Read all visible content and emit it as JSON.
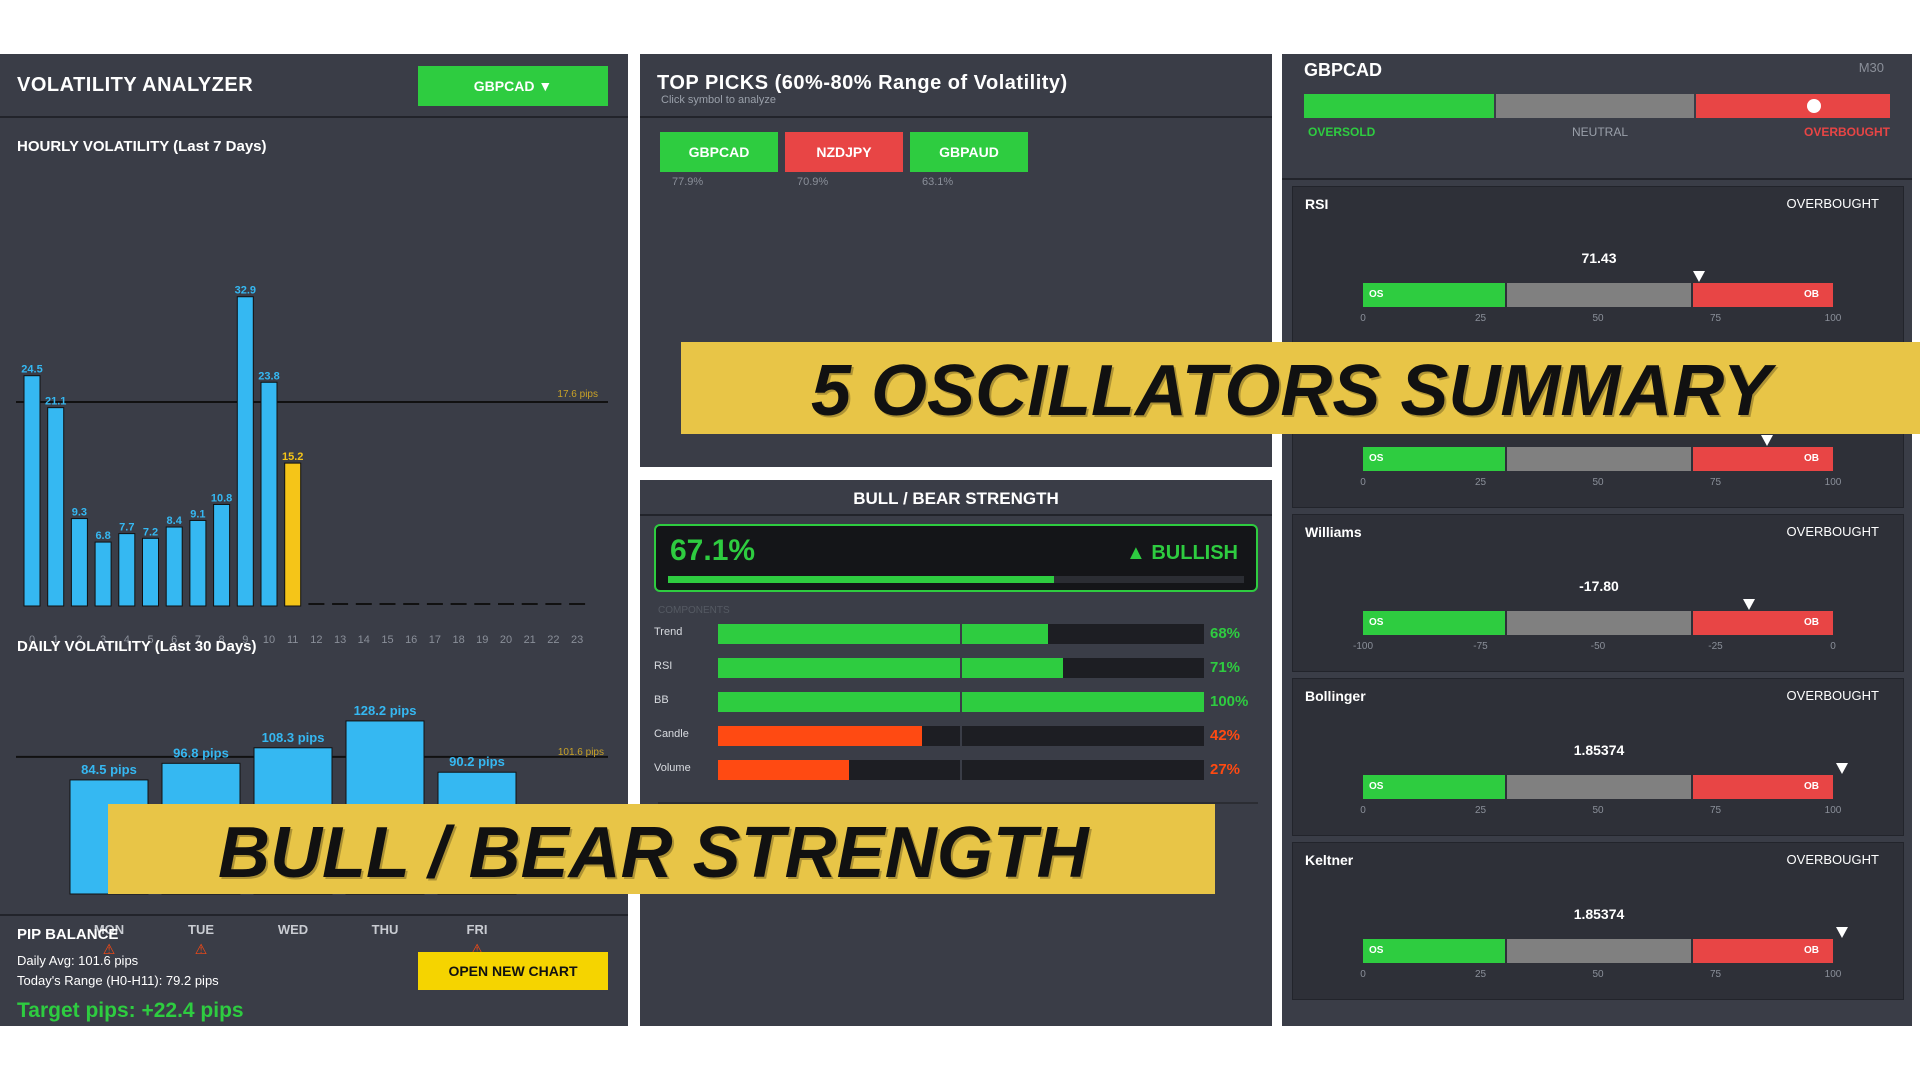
{
  "left": {
    "title": "VOLATILITY ANALYZER",
    "symbol_button": "GBPCAD ▼",
    "hourly": {
      "title": "HOURLY VOLATILITY (Last 7 Days)",
      "avg_label": "17.6 pips",
      "hours": [
        "0",
        "1",
        "2",
        "3",
        "4",
        "5",
        "6",
        "7",
        "8",
        "9",
        "10",
        "11",
        "12",
        "13",
        "14",
        "15",
        "16",
        "17",
        "18",
        "19",
        "20",
        "21",
        "22",
        "23"
      ],
      "values": [
        24.5,
        21.1,
        9.3,
        6.8,
        7.7,
        7.2,
        8.4,
        9.1,
        10.8,
        32.9,
        23.8,
        15.2
      ],
      "value_labels": [
        "24.5",
        "21.1",
        "9.3",
        "6.8",
        "7.7",
        "7.2",
        "8.4",
        "9.1",
        "10.8",
        "32.9",
        "23.8",
        "15.2"
      ],
      "current_hour_index": 11
    },
    "daily": {
      "title": "DAILY VOLATILITY (Last 30 Days)",
      "avg_label": "101.6 pips",
      "days": [
        "MON",
        "TUE",
        "WED",
        "THU",
        "FRI"
      ],
      "values": [
        84.5,
        96.8,
        108.3,
        128.2,
        90.2
      ],
      "value_labels": [
        "84.5 pips",
        "96.8 pips",
        "108.3 pips",
        "128.2 pips",
        "90.2 pips"
      ],
      "warnings": [
        "⚠",
        "⚠",
        "",
        "",
        "⚠"
      ]
    },
    "pip_balance": {
      "title": "PIP BALANCE",
      "daily_avg": "Daily Avg: 101.6 pips",
      "todays_range": "Today's Range (H0-H11): 79.2 pips",
      "target": "Target pips: +22.4 pips",
      "open_chart_button": "OPEN NEW CHART"
    }
  },
  "top_picks": {
    "title": "TOP PICKS (60%-80% Range of Volatility)",
    "subtitle": "Click symbol to analyze",
    "picks": [
      {
        "symbol": "GBPCAD",
        "pct": "77.9%",
        "color": "#2ecc40"
      },
      {
        "symbol": "NZDJPY",
        "pct": "70.9%",
        "color": "#e84545"
      },
      {
        "symbol": "GBPAUD",
        "pct": "63.1%",
        "color": "#2ecc40"
      }
    ]
  },
  "bull_bear": {
    "title": "BULL / BEAR STRENGTH",
    "score": "67.1%",
    "score_value": 67.1,
    "direction": "▲ BULLISH",
    "components_label": "COMPONENTS",
    "components": [
      {
        "name": "Trend",
        "value": 68,
        "label": "68%",
        "color": "#2ecc40"
      },
      {
        "name": "RSI",
        "value": 71,
        "label": "71%",
        "color": "#2ecc40"
      },
      {
        "name": "BB",
        "value": 100,
        "label": "100%",
        "color": "#2ecc40"
      },
      {
        "name": "Candle",
        "value": 42,
        "label": "42%",
        "color": "#ff4a12"
      },
      {
        "name": "Volume",
        "value": 27,
        "label": "27%",
        "color": "#ff4a12"
      }
    ]
  },
  "summary": {
    "symbol": "GBPCAD",
    "timeframe": "M30",
    "oversold": "OVERSOLD",
    "neutral": "NEUTRAL",
    "overbought": "OVERBOUGHT",
    "marker_position": 0.87
  },
  "oscillators": [
    {
      "name": "RSI",
      "status": "OVERBOUGHT",
      "value": "71.43",
      "marker": 0.7143,
      "ticks": [
        "0",
        "25",
        "50",
        "75",
        "100"
      ]
    },
    {
      "name": "",
      "status": "",
      "value": "",
      "marker": 0.86,
      "ticks": [
        "0",
        "25",
        "50",
        "75",
        "100"
      ]
    },
    {
      "name": "Williams",
      "status": "OVERBOUGHT",
      "value": "-17.80",
      "marker": 0.822,
      "ticks": [
        "-100",
        "-75",
        "-50",
        "-25",
        "0"
      ]
    },
    {
      "name": "Bollinger",
      "status": "OVERBOUGHT",
      "value": "1.85374",
      "marker": 1.02,
      "ticks": [
        "0",
        "25",
        "50",
        "75",
        "100"
      ]
    },
    {
      "name": "Keltner",
      "status": "OVERBOUGHT",
      "value": "1.85374",
      "marker": 1.02,
      "ticks": [
        "0",
        "25",
        "50",
        "75",
        "100"
      ]
    }
  ],
  "osc_labels": {
    "os": "OS",
    "ob": "OB"
  },
  "banners": {
    "oscillators": "5 OSCILLATORS SUMMARY",
    "bull_bear": "BULL / BEAR STRENGTH"
  },
  "colors": {
    "green": "#2ecc40",
    "red": "#e84545",
    "blue": "#35b8f2",
    "yellow": "#f5c518",
    "orange": "#ff4a12",
    "panel": "#3a3d47"
  }
}
